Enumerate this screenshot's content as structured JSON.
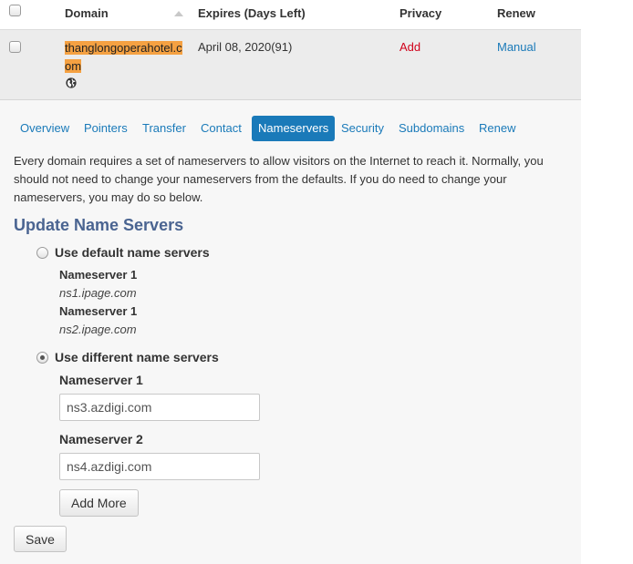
{
  "table": {
    "headers": {
      "domain": "Domain",
      "expires": "Expires (Days Left)",
      "privacy": "Privacy",
      "renew": "Renew"
    },
    "row": {
      "domain_name": "thanglongoperahotel.com",
      "expires": "April 08, 2020(91)",
      "privacy": "Add",
      "renew": "Manual"
    }
  },
  "tabs": [
    {
      "label": "Overview"
    },
    {
      "label": "Pointers"
    },
    {
      "label": "Transfer"
    },
    {
      "label": "Contact"
    },
    {
      "label": "Nameservers",
      "active": true
    },
    {
      "label": "Security"
    },
    {
      "label": "Subdomains"
    },
    {
      "label": "Renew"
    }
  ],
  "description": "Every domain requires a set of nameservers to allow visitors on the Internet to reach it. Normally, you should not need to change your nameservers from the defaults. If you do need to change your nameservers, you may do so below.",
  "section_title": "Update Name Servers",
  "default_option": {
    "label": "Use default name servers",
    "ns1_label": "Nameserver 1",
    "ns1_value": "ns1.ipage.com",
    "ns2_label": "Nameserver 1",
    "ns2_value": "ns2.ipage.com"
  },
  "custom_option": {
    "label": "Use different name servers",
    "ns1_label": "Nameserver 1",
    "ns1_value": "ns3.azdigi.com",
    "ns2_label": "Nameserver 2",
    "ns2_value": "ns4.azdigi.com"
  },
  "buttons": {
    "add_more": "Add More",
    "save": "Save"
  },
  "colors": {
    "accent": "#1a7ab9",
    "domain_highlight": "#f5a142",
    "privacy_link": "#d0021b",
    "section_title": "#4a6491"
  }
}
